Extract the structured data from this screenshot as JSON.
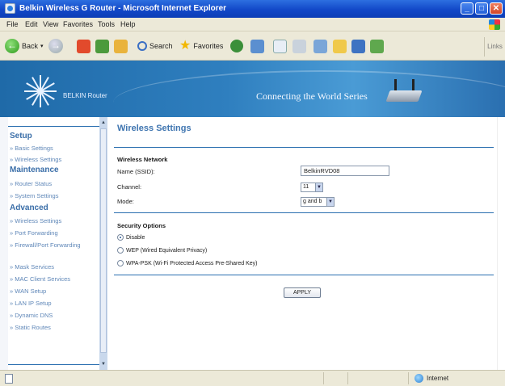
{
  "window": {
    "title": "Belkin Wireless G Router - Microsoft Internet Explorer",
    "minimize": "_",
    "maximize": "□",
    "close": "✕"
  },
  "menu": [
    "File",
    "Edit",
    "View",
    "Favorites",
    "Tools",
    "Help"
  ],
  "toolbar": {
    "back_label": "Back",
    "search_label": "Search",
    "favorites_label": "Favorites",
    "links_label": "Links"
  },
  "banner": {
    "brand": "BELKIN Router",
    "tagline": "Connecting the World Series"
  },
  "sidebar": {
    "setup_heading": "Setup",
    "setup_links": [
      "Basic Settings",
      "Wireless Settings"
    ],
    "maintenance_heading": "Maintenance",
    "maintenance_links": [
      "Router Status",
      "System Settings"
    ],
    "advanced_heading": "Advanced",
    "advanced_links": [
      "Wireless Settings",
      "Port Forwarding",
      "Firewall/Port Forwarding",
      "Mask Services",
      "MAC Client Services",
      "WAN Setup",
      "LAN IP Setup",
      "Dynamic DNS",
      "Static Routes"
    ]
  },
  "content": {
    "page_title": "Wireless Settings",
    "network_group": "Wireless Network",
    "ssid_label": "Name (SSID):",
    "ssid_value": "BelkinRVD08",
    "channel_label": "Channel:",
    "channel_value": "11",
    "mode_label": "Mode:",
    "mode_value": "g and b",
    "security_group": "Security Options",
    "security_options": [
      {
        "label": "Disable",
        "selected": true
      },
      {
        "label": "WEP (Wired Equivalent Privacy)",
        "selected": false
      },
      {
        "label": "WPA-PSK (Wi-Fi Protected Access Pre-Shared Key)",
        "selected": false
      }
    ],
    "apply_label": "APPLY"
  },
  "status": {
    "zone": "Internet"
  },
  "icons": {
    "back": "back-arrow-icon",
    "forward": "forward-arrow-icon",
    "stop": "stop-icon",
    "refresh": "refresh-icon",
    "home": "home-icon",
    "search": "search-icon",
    "favorites": "favorites-star-icon",
    "media": "media-icon",
    "history": "history-icon",
    "mail": "mail-icon",
    "print": "print-icon",
    "edit": "edit-icon",
    "folder": "folder-icon",
    "messenger": "messenger-icon",
    "zone": "globe-icon"
  },
  "colors": {
    "accent": "#2a6fb0",
    "link": "#5f87b8",
    "heading": "#3f75b0",
    "titlebar": "#1248c8"
  }
}
